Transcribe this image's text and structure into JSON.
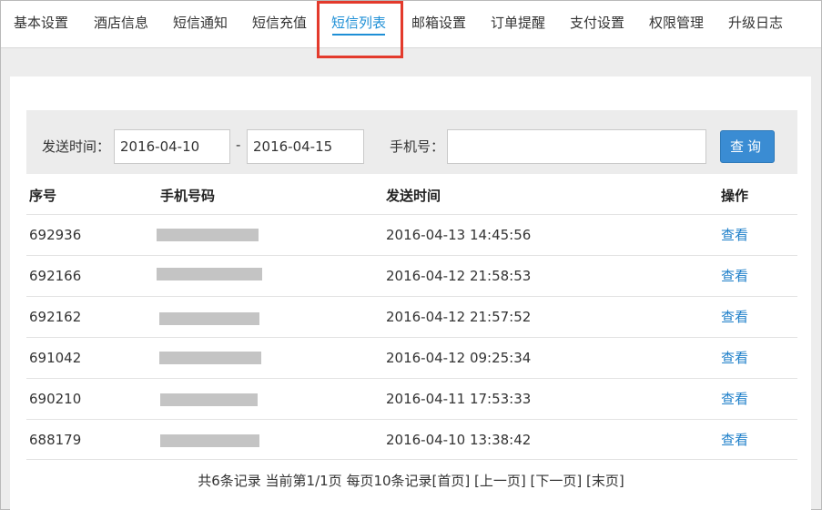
{
  "nav": {
    "tabs": [
      {
        "label": "基本设置"
      },
      {
        "label": "酒店信息"
      },
      {
        "label": "短信通知"
      },
      {
        "label": "短信充值"
      },
      {
        "label": "短信列表",
        "active": true
      },
      {
        "label": "邮箱设置"
      },
      {
        "label": "订单提醒"
      },
      {
        "label": "支付设置"
      },
      {
        "label": "权限管理"
      },
      {
        "label": "升级日志"
      }
    ],
    "accent_color": "#1e8fd6",
    "highlight_color": "#e33a2c"
  },
  "filter": {
    "send_time_label": "发送时间：",
    "date_from": "2016-04-10",
    "date_sep": "-",
    "date_to": "2016-04-15",
    "phone_label": "手机号：",
    "phone_value": "",
    "query_button": "查询"
  },
  "table": {
    "headers": {
      "id": "序号",
      "phone": "手机号码",
      "time": "发送时间",
      "action": "操作"
    },
    "rows": [
      {
        "id": "692936",
        "phone": "(redacted)",
        "time": "2016-04-13 14:45:56",
        "action": "查看"
      },
      {
        "id": "692166",
        "phone": "(redacted)",
        "time": "2016-04-12 21:58:53",
        "action": "查看"
      },
      {
        "id": "692162",
        "phone": "(redacted)",
        "time": "2016-04-12 21:57:52",
        "action": "查看"
      },
      {
        "id": "691042",
        "phone": "(redacted)",
        "time": "2016-04-12 09:25:34",
        "action": "查看"
      },
      {
        "id": "690210",
        "phone": "(redacted)",
        "time": "2016-04-11 17:53:33",
        "action": "查看"
      },
      {
        "id": "688179",
        "phone": "(redacted)",
        "time": "2016-04-10 13:38:42",
        "action": "查看"
      }
    ]
  },
  "pager": {
    "summary": "共6条记录 当前第1/1页 每页10条记录",
    "first": "[首页]",
    "prev": "[上一页]",
    "next": "[下一页]",
    "last": "[末页]"
  }
}
